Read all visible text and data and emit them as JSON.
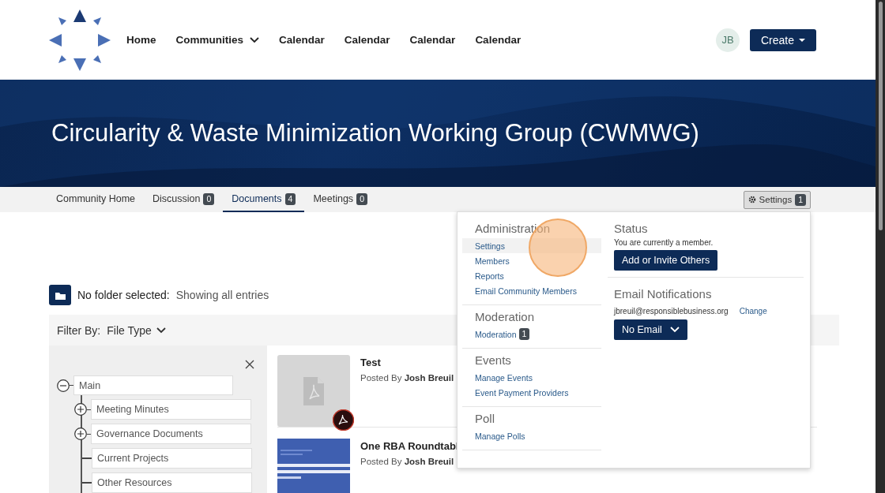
{
  "header": {
    "nav": [
      {
        "label": "Home",
        "kind": "link"
      },
      {
        "label": "Communities",
        "kind": "dropdown"
      },
      {
        "label": "Calendar",
        "kind": "link"
      },
      {
        "label": "Calendar",
        "kind": "link"
      },
      {
        "label": "Calendar",
        "kind": "link"
      },
      {
        "label": "Calendar",
        "kind": "link"
      }
    ],
    "avatar": "JB",
    "create_button": "Create"
  },
  "banner": {
    "title": "Circularity & Waste Minimization Working Group (CWMWG)"
  },
  "tabs": [
    {
      "label": "Community Home",
      "selected": false
    },
    {
      "label": "Discussion",
      "count": "0",
      "selected": false
    },
    {
      "label": "Documents",
      "count": "4",
      "selected": true
    },
    {
      "label": "Meetings",
      "count": "0",
      "selected": false
    }
  ],
  "settings_button": {
    "label": "Settings",
    "count": "1"
  },
  "folder_status": {
    "label": "No folder selected:",
    "value": "Showing all entries"
  },
  "filter": {
    "label": "Filter By:",
    "value": "File Type"
  },
  "folder_tree": {
    "label": "Main",
    "expanded": true,
    "children": [
      {
        "label": "Meeting Minutes",
        "expanded": false
      },
      {
        "label": "Governance Documents",
        "expanded": false
      },
      {
        "label": "Current Projects"
      },
      {
        "label": "Other Resources"
      }
    ]
  },
  "documents": [
    {
      "title": "Test",
      "posted_by": "Posted By",
      "author": "Josh Breuil",
      "kind": "pdf"
    },
    {
      "title": "One RBA Roundtabl",
      "posted_by": "Posted By",
      "author": "Josh Breuil",
      "kind": "picture"
    }
  ],
  "settings_menu": {
    "sections": [
      {
        "heading": "Administration",
        "items": [
          {
            "label": "Settings",
            "selected": true
          },
          {
            "label": "Members",
            "selected": false
          },
          {
            "label": "Reports",
            "selected": false
          },
          {
            "label": "Email Community Members",
            "selected": false
          }
        ]
      },
      {
        "heading": "Moderation",
        "items": [
          {
            "label": "Moderation",
            "count": "1",
            "selected": false
          }
        ]
      },
      {
        "heading": "Events",
        "items": [
          {
            "label": "Manage Events",
            "selected": false
          },
          {
            "label": "Event Payment Providers",
            "selected": false
          }
        ]
      },
      {
        "heading": "Poll",
        "items": [
          {
            "label": "Manage Polls",
            "selected": false
          }
        ]
      }
    ],
    "status": {
      "heading": "Status",
      "text": "You are currently a member.",
      "button": "Add or Invite Others"
    },
    "email_notifications": {
      "heading": "Email Notifications",
      "email": "jbreuil@responsiblebusiness.org",
      "change_link": "Change",
      "button": "No Email"
    }
  }
}
